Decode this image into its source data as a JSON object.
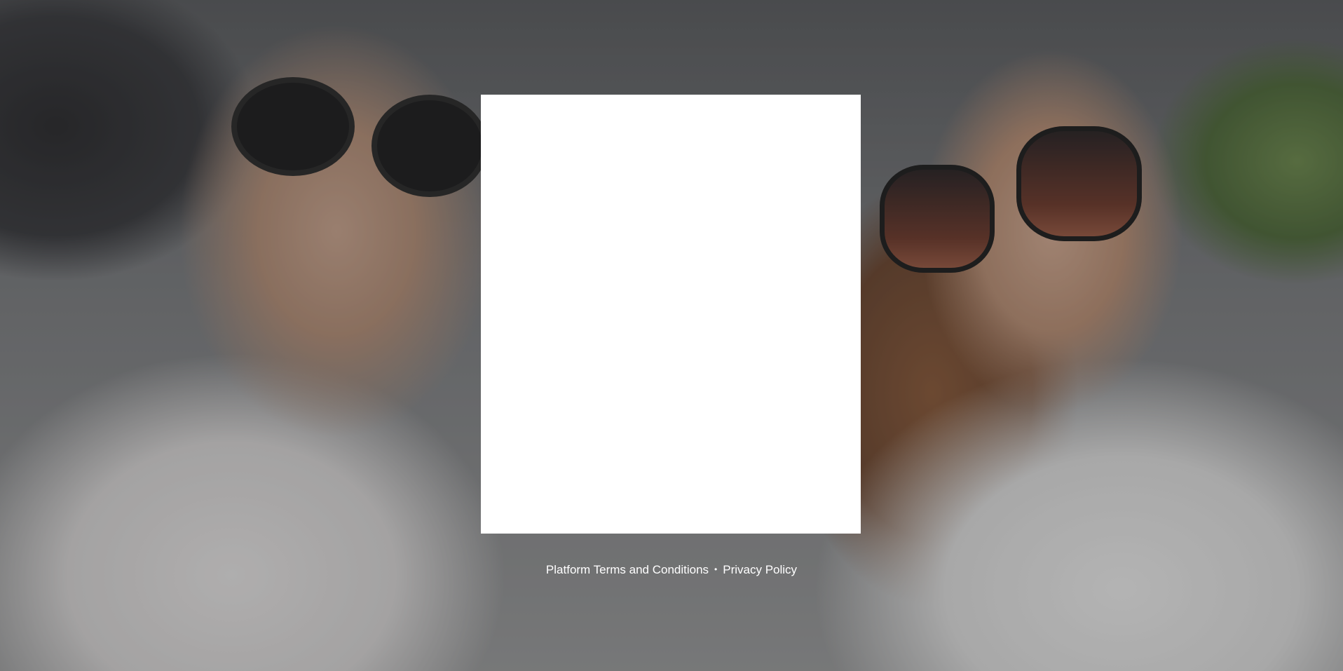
{
  "footer": {
    "terms_link": "Platform Terms and Conditions",
    "separator": "•",
    "privacy_link": "Privacy Policy"
  },
  "colors": {
    "card_background": "#ffffff",
    "footer_text": "#ffffff"
  }
}
